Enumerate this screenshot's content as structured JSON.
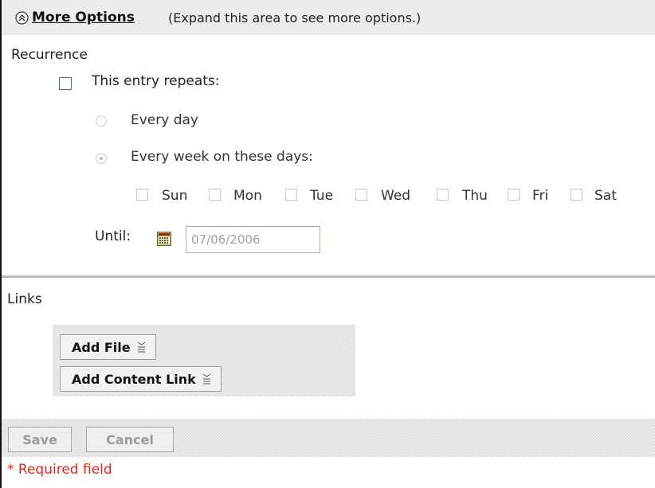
{
  "more_options": {
    "link_label": "More Options",
    "hint": "(Expand this area to see more options.)"
  },
  "recurrence": {
    "section_label": "Recurrence",
    "repeat_label": "This entry repeats:",
    "repeat_checked": false,
    "option_every_day": "Every day",
    "option_every_week": "Every week on these days:",
    "selected_option": "Every week on these days:",
    "days": [
      "Sun",
      "Mon",
      "Tue",
      "Wed",
      "Thu",
      "Fri",
      "Sat"
    ],
    "until_label": "Until:",
    "until_value": "07/06/2006"
  },
  "links": {
    "section_label": "Links",
    "add_file_label": "Add File",
    "add_content_link_label": "Add Content Link"
  },
  "footer": {
    "save_label": "Save",
    "cancel_label": "Cancel",
    "required_note": "* Required field"
  },
  "colors": {
    "header_bg": "#ececec",
    "required_red": "#e0271c",
    "checkbox_border": "#4a6c8f"
  }
}
